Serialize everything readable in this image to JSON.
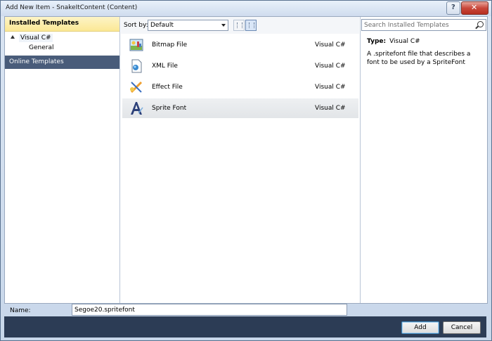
{
  "window": {
    "title": "Add New Item - SnakeItContent (Content)",
    "help_label": "?",
    "close_label": "✕"
  },
  "left": {
    "installed_header": "Installed Templates",
    "tree_root": "Visual C#",
    "tree_child": "General",
    "online_header": "Online Templates"
  },
  "toolbar": {
    "sort_label": "Sort by:",
    "sort_value": "Default"
  },
  "items": [
    {
      "name": "Bitmap File",
      "lang": "Visual C#",
      "icon": "bitmap-icon"
    },
    {
      "name": "XML File",
      "lang": "Visual C#",
      "icon": "xml-icon"
    },
    {
      "name": "Effect File",
      "lang": "Visual C#",
      "icon": "effect-icon"
    },
    {
      "name": "Sprite Font",
      "lang": "Visual C#",
      "icon": "sprite-font-icon",
      "selected": true
    }
  ],
  "details": {
    "search_placeholder": "Search Installed Templates",
    "type_label": "Type:",
    "type_value": "Visual C#",
    "description": "A .spritefont file that describes a font to be used by a SpriteFont"
  },
  "form": {
    "name_label": "Name:",
    "name_value": "Segoe20.spritefont"
  },
  "buttons": {
    "add": "Add",
    "cancel": "Cancel"
  }
}
